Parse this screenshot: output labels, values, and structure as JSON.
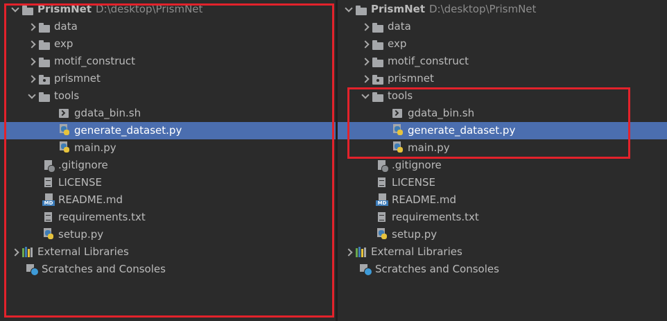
{
  "highlight_color": "#e3222b",
  "selection_color": "#4b6eaf",
  "left_panel": {
    "root": {
      "name": "PrismNet",
      "path": "D:\\desktop\\PrismNet"
    },
    "items": [
      {
        "label": "data",
        "icon": "folder-icon"
      },
      {
        "label": "exp",
        "icon": "folder-icon"
      },
      {
        "label": "motif_construct",
        "icon": "folder-icon"
      },
      {
        "label": "prismnet",
        "icon": "package-icon"
      },
      {
        "label": "tools",
        "icon": "folder-icon"
      },
      {
        "label": "gdata_bin.sh",
        "icon": "shell-script-icon"
      },
      {
        "label": "generate_dataset.py",
        "icon": "python-file-icon",
        "selected": true
      },
      {
        "label": "main.py",
        "icon": "python-file-icon"
      },
      {
        "label": ".gitignore",
        "icon": "gitignore-icon"
      },
      {
        "label": "LICENSE",
        "icon": "text-file-icon"
      },
      {
        "label": "README.md",
        "icon": "markdown-icon"
      },
      {
        "label": "requirements.txt",
        "icon": "text-file-icon"
      },
      {
        "label": "setup.py",
        "icon": "python-file-icon"
      },
      {
        "label": "External Libraries",
        "icon": "libraries-icon"
      },
      {
        "label": "Scratches and Consoles",
        "icon": "scratches-icon"
      }
    ]
  },
  "right_panel": {
    "root": {
      "name": "PrismNet",
      "path": "D:\\desktop\\PrismNet"
    },
    "items": [
      {
        "label": "data",
        "icon": "folder-icon"
      },
      {
        "label": "exp",
        "icon": "folder-icon"
      },
      {
        "label": "motif_construct",
        "icon": "folder-icon"
      },
      {
        "label": "prismnet",
        "icon": "package-icon"
      },
      {
        "label": "tools",
        "icon": "folder-icon"
      },
      {
        "label": "gdata_bin.sh",
        "icon": "shell-script-icon"
      },
      {
        "label": "generate_dataset.py",
        "icon": "python-file-icon",
        "selected": true
      },
      {
        "label": "main.py",
        "icon": "python-file-icon"
      },
      {
        "label": ".gitignore",
        "icon": "gitignore-icon"
      },
      {
        "label": "LICENSE",
        "icon": "text-file-icon"
      },
      {
        "label": "README.md",
        "icon": "markdown-icon"
      },
      {
        "label": "requirements.txt",
        "icon": "text-file-icon"
      },
      {
        "label": "setup.py",
        "icon": "python-file-icon"
      },
      {
        "label": "External Libraries",
        "icon": "libraries-icon"
      },
      {
        "label": "Scratches and Consoles",
        "icon": "scratches-icon"
      }
    ]
  }
}
